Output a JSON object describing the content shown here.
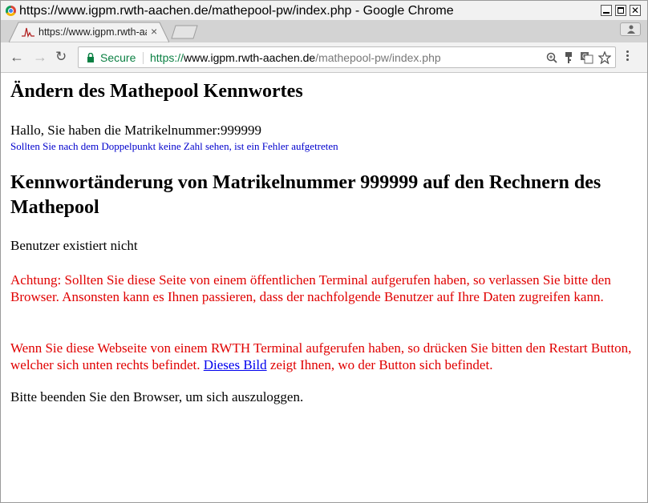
{
  "window": {
    "title": "https://www.igpm.rwth-aachen.de/mathepool-pw/index.php - Google Chrome"
  },
  "tab": {
    "title": "https://www.igpm.rwth-aachen.de/mathepool-pw/index.php",
    "close_icon": "×"
  },
  "toolbar": {
    "secure_label": "Secure",
    "url_scheme": "https://",
    "url_host": "www.igpm.rwth-aachen.de",
    "url_path": "/mathepool-pw/index.php",
    "icons": [
      "back-icon",
      "forward-icon",
      "reload-icon",
      "lock-icon",
      "zoom-icon",
      "key-icon",
      "translate-icon",
      "star-icon",
      "menu-icon"
    ]
  },
  "page": {
    "heading1": "Ändern des Mathepool Kennwortes",
    "greeting": "Hallo, Sie haben die Matrikelnummer:999999",
    "hint": "Sollten Sie nach dem Doppelpunkt keine Zahl sehen, ist ein Fehler aufgetreten",
    "heading2": "Kennwortänderung von Matrikelnummer 999999 auf den Rechnern des Mathepool",
    "user_status": "Benutzer existiert nicht",
    "warning1": "Achtung: Sollten Sie diese Seite von einem öffentlichen Terminal aufgerufen haben, so verlassen Sie bitte den Browser. Ansonsten kann es Ihnen passieren, dass der nachfolgende Benutzer auf Ihre Daten zugreifen kann.",
    "warning2_before": "Wenn Sie diese Webseite von einem RWTH Terminal aufgerufen haben, so drücken Sie bitten den Restart Button, welcher sich unten rechts befindet. ",
    "warning2_link": "Dieses Bild",
    "warning2_after": " zeigt Ihnen, wo der Button sich befindet.",
    "closing": "Bitte beenden Sie den Browser, um sich auszuloggen."
  },
  "colors": {
    "warning_text": "#e00000",
    "hint_text": "#0000cc",
    "link": "#0000ee",
    "secure_green": "#0b8043"
  }
}
